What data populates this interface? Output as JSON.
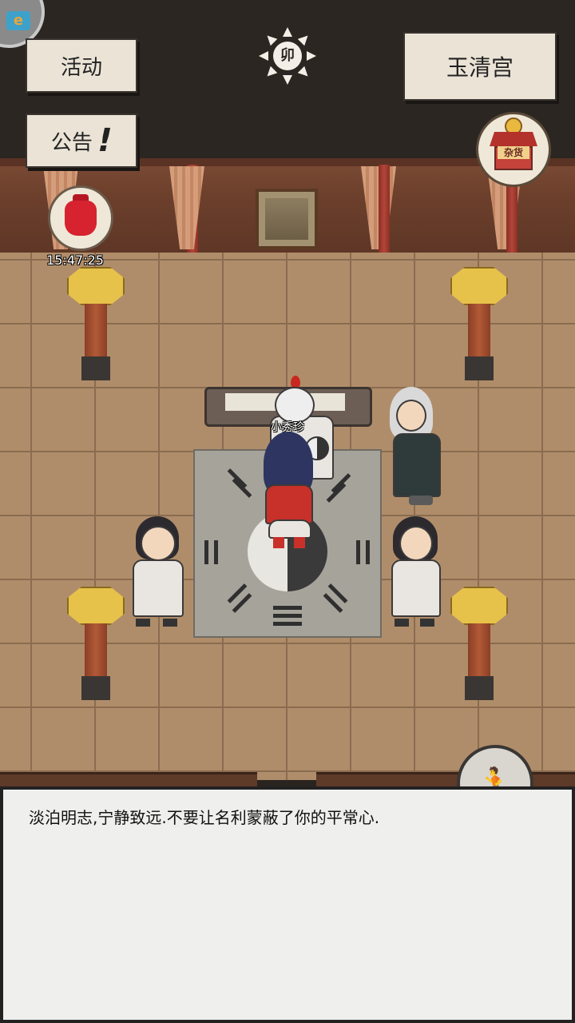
{
  "top_bar": {
    "activity_label": "活动",
    "notice_label": "公告",
    "notice_alert_mark": "!",
    "location_label": "玉清宫",
    "time_emblem_glyph": "卯"
  },
  "shop": {
    "sign_text": "杂货"
  },
  "red_bag": {
    "timer": "15:47:25"
  },
  "scene": {
    "npc_name": "小秀珍"
  },
  "dialog": {
    "text": "淡泊明志,宁静致远.不要让名利蒙蔽了你的平常心."
  },
  "icons": {
    "corner_logo": "app-logo-icon",
    "time": "sun-emblem-icon",
    "shop": "shop-stall-icon",
    "bag": "red-bag-icon",
    "run": "run-icon"
  },
  "colors": {
    "paper": "#eae3d6",
    "floor": "#b08d6a",
    "wall": "#6b3f2b",
    "bag_red": "#d6232f",
    "dialog_bg": "#efefed"
  }
}
